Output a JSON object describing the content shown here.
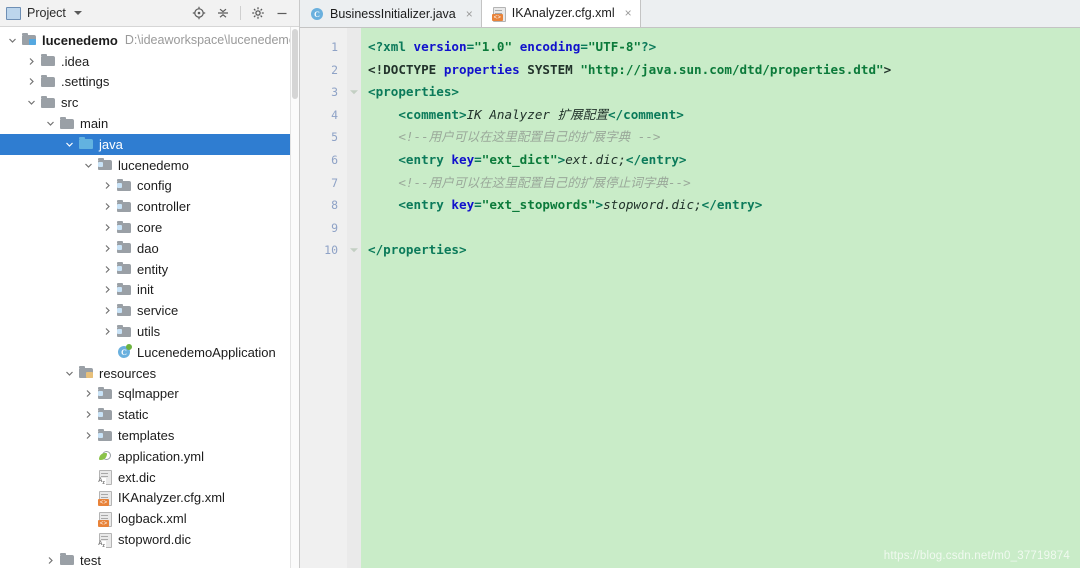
{
  "sidebar": {
    "toolbar": {
      "title": "Project",
      "project_icon": "project-panel-icon",
      "dropdown_icon": "chevron-down-icon",
      "buttons": [
        {
          "name": "locate-icon",
          "glyph": "⊕",
          "tooltip": "Select Opened File"
        },
        {
          "name": "collapse-all-icon",
          "glyph": "≃",
          "tooltip": "Collapse All"
        },
        {
          "name": "gear-icon",
          "glyph": "⚙",
          "tooltip": "Settings"
        },
        {
          "name": "minimize-icon",
          "glyph": "—",
          "tooltip": "Hide"
        }
      ]
    },
    "tree": [
      {
        "label": "lucenedemo",
        "path": "D:\\ideaworkspace\\lucenedemo",
        "indent": 0,
        "arrow": "down",
        "icon": "folder-root",
        "bold": true,
        "selected": false
      },
      {
        "label": ".idea",
        "path": "",
        "indent": 1,
        "arrow": "right",
        "icon": "folder-gray",
        "bold": false,
        "selected": false
      },
      {
        "label": ".settings",
        "path": "",
        "indent": 1,
        "arrow": "right",
        "icon": "folder-gray",
        "bold": false,
        "selected": false
      },
      {
        "label": "src",
        "path": "",
        "indent": 1,
        "arrow": "down",
        "icon": "folder-gray",
        "bold": false,
        "selected": false
      },
      {
        "label": "main",
        "path": "",
        "indent": 2,
        "arrow": "down",
        "icon": "folder-gray",
        "bold": false,
        "selected": false
      },
      {
        "label": "java",
        "path": "",
        "indent": 3,
        "arrow": "down",
        "icon": "folder-blue",
        "bold": false,
        "selected": true
      },
      {
        "label": "lucenedemo",
        "path": "",
        "indent": 4,
        "arrow": "down",
        "icon": "folder-package",
        "bold": false,
        "selected": false
      },
      {
        "label": "config",
        "path": "",
        "indent": 5,
        "arrow": "right",
        "icon": "folder-package",
        "bold": false,
        "selected": false
      },
      {
        "label": "controller",
        "path": "",
        "indent": 5,
        "arrow": "right",
        "icon": "folder-package",
        "bold": false,
        "selected": false
      },
      {
        "label": "core",
        "path": "",
        "indent": 5,
        "arrow": "right",
        "icon": "folder-package",
        "bold": false,
        "selected": false
      },
      {
        "label": "dao",
        "path": "",
        "indent": 5,
        "arrow": "right",
        "icon": "folder-package",
        "bold": false,
        "selected": false
      },
      {
        "label": "entity",
        "path": "",
        "indent": 5,
        "arrow": "right",
        "icon": "folder-package",
        "bold": false,
        "selected": false
      },
      {
        "label": "init",
        "path": "",
        "indent": 5,
        "arrow": "right",
        "icon": "folder-package",
        "bold": false,
        "selected": false
      },
      {
        "label": "service",
        "path": "",
        "indent": 5,
        "arrow": "right",
        "icon": "folder-package",
        "bold": false,
        "selected": false
      },
      {
        "label": "utils",
        "path": "",
        "indent": 5,
        "arrow": "right",
        "icon": "folder-package",
        "bold": false,
        "selected": false
      },
      {
        "label": "LucenedemoApplication",
        "path": "",
        "indent": 5,
        "arrow": "none",
        "icon": "java-class-spring",
        "bold": false,
        "selected": false
      },
      {
        "label": "resources",
        "path": "",
        "indent": 3,
        "arrow": "down",
        "icon": "folder-resources",
        "bold": false,
        "selected": false
      },
      {
        "label": "sqlmapper",
        "path": "",
        "indent": 4,
        "arrow": "right",
        "icon": "folder-package",
        "bold": false,
        "selected": false
      },
      {
        "label": "static",
        "path": "",
        "indent": 4,
        "arrow": "right",
        "icon": "folder-package",
        "bold": false,
        "selected": false
      },
      {
        "label": "templates",
        "path": "",
        "indent": 4,
        "arrow": "right",
        "icon": "folder-package",
        "bold": false,
        "selected": false
      },
      {
        "label": "application.yml",
        "path": "",
        "indent": 4,
        "arrow": "none",
        "icon": "yml-file",
        "bold": false,
        "selected": false
      },
      {
        "label": "ext.dic",
        "path": "",
        "indent": 4,
        "arrow": "none",
        "icon": "text-az-file",
        "bold": false,
        "selected": false
      },
      {
        "label": "IKAnalyzer.cfg.xml",
        "path": "",
        "indent": 4,
        "arrow": "none",
        "icon": "xml-file",
        "bold": false,
        "selected": false
      },
      {
        "label": "logback.xml",
        "path": "",
        "indent": 4,
        "arrow": "none",
        "icon": "xml-file",
        "bold": false,
        "selected": false
      },
      {
        "label": "stopword.dic",
        "path": "",
        "indent": 4,
        "arrow": "none",
        "icon": "text-az-file",
        "bold": false,
        "selected": false
      },
      {
        "label": "test",
        "path": "",
        "indent": 2,
        "arrow": "right",
        "icon": "folder-gray",
        "bold": false,
        "selected": false
      }
    ]
  },
  "editor": {
    "tabs": [
      {
        "label": "BusinessInitializer.java",
        "icon": "java-class-icon",
        "active": false,
        "close": "×"
      },
      {
        "label": "IKAnalyzer.cfg.xml",
        "icon": "xml-file-icon",
        "active": true,
        "close": "×"
      }
    ],
    "line_numbers": [
      "1",
      "2",
      "3",
      "4",
      "5",
      "6",
      "7",
      "8",
      "9",
      "10"
    ],
    "fold_lines": [
      3,
      10
    ],
    "code_lines": [
      {
        "n": 1,
        "indent": 0,
        "tokens": [
          {
            "t": "tag",
            "s": "<?xml "
          },
          {
            "t": "attr",
            "s": "version"
          },
          {
            "t": "tag",
            "s": "="
          },
          {
            "t": "val",
            "s": "\"1.0\""
          },
          {
            "t": "tag",
            "s": " "
          },
          {
            "t": "attr",
            "s": "encoding"
          },
          {
            "t": "tag",
            "s": "="
          },
          {
            "t": "val",
            "s": "\"UTF-8\""
          },
          {
            "t": "tag",
            "s": "?>"
          }
        ]
      },
      {
        "n": 2,
        "indent": 0,
        "tokens": [
          {
            "t": "dt",
            "s": "<!DOCTYPE "
          },
          {
            "t": "attr",
            "s": "properties"
          },
          {
            "t": "dt",
            "s": " SYSTEM "
          },
          {
            "t": "val",
            "s": "\"http://java.sun.com/dtd/properties.dtd\""
          },
          {
            "t": "dt",
            "s": ">"
          }
        ]
      },
      {
        "n": 3,
        "indent": 0,
        "tokens": [
          {
            "t": "tag",
            "s": "<properties>"
          }
        ]
      },
      {
        "n": 4,
        "indent": 1,
        "tokens": [
          {
            "t": "tag",
            "s": "<comment>"
          },
          {
            "t": "txt",
            "s": "IK Analyzer 扩展配置"
          },
          {
            "t": "tag",
            "s": "</comment>"
          }
        ]
      },
      {
        "n": 5,
        "indent": 1,
        "tokens": [
          {
            "t": "cmt",
            "s": "<!--用户可以在这里配置自己的扩展字典 -->"
          }
        ]
      },
      {
        "n": 6,
        "indent": 1,
        "tokens": [
          {
            "t": "tag",
            "s": "<entry "
          },
          {
            "t": "attr",
            "s": "key"
          },
          {
            "t": "tag",
            "s": "="
          },
          {
            "t": "val",
            "s": "\"ext_dict\""
          },
          {
            "t": "tag",
            "s": ">"
          },
          {
            "t": "txt",
            "s": "ext.dic;"
          },
          {
            "t": "tag",
            "s": "</entry>"
          }
        ]
      },
      {
        "n": 7,
        "indent": 1,
        "tokens": [
          {
            "t": "cmt",
            "s": "<!--用户可以在这里配置自己的扩展停止词字典-->"
          }
        ]
      },
      {
        "n": 8,
        "indent": 1,
        "tokens": [
          {
            "t": "tag",
            "s": "<entry "
          },
          {
            "t": "attr",
            "s": "key"
          },
          {
            "t": "tag",
            "s": "="
          },
          {
            "t": "val",
            "s": "\"ext_stopwords\""
          },
          {
            "t": "tag",
            "s": ">"
          },
          {
            "t": "txt",
            "s": "stopword.dic;"
          },
          {
            "t": "tag",
            "s": "</entry>"
          }
        ]
      },
      {
        "n": 9,
        "indent": 0,
        "tokens": []
      },
      {
        "n": 10,
        "indent": 0,
        "tokens": [
          {
            "t": "tag",
            "s": "</properties>"
          }
        ]
      }
    ],
    "watermark": "https://blog.csdn.net/m0_37719874"
  },
  "colors": {
    "editor_background": "#c9ecc8",
    "selection_blue": "#2f7dd1",
    "gutter_background": "#f0f0f0",
    "line_number": "#8ea2c6",
    "tag": "#0b7a5a",
    "attribute": "#1111cc",
    "value": "#0b7a3a",
    "comment": "#9aa89a"
  }
}
